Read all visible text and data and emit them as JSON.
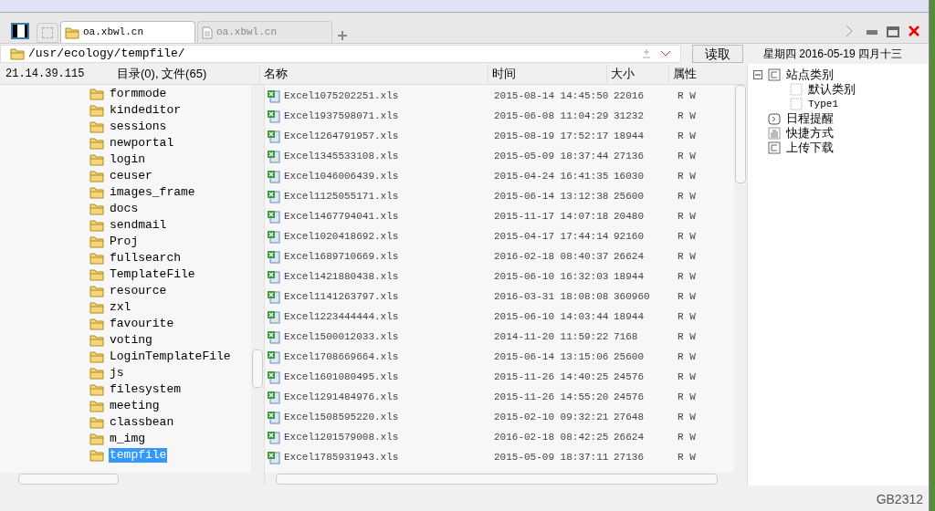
{
  "tabs": [
    {
      "label": "oa.xbwl.cn",
      "kind": "folder",
      "selected": true
    },
    {
      "label": "oa.xbwl.cn",
      "kind": "file",
      "selected": false
    }
  ],
  "path": "/usr/ecology/tempfile/",
  "read_button": "读取",
  "left_panel": {
    "host": "21.14.39.115",
    "counts": "目录(0), 文件(65)",
    "folders": [
      {
        "name": "formmode",
        "selected": false
      },
      {
        "name": "kindeditor",
        "selected": false
      },
      {
        "name": "sessions",
        "selected": false
      },
      {
        "name": "newportal",
        "selected": false
      },
      {
        "name": "login",
        "selected": false
      },
      {
        "name": "ceuser",
        "selected": false
      },
      {
        "name": "images_frame",
        "selected": false
      },
      {
        "name": "docs",
        "selected": false
      },
      {
        "name": "sendmail",
        "selected": false
      },
      {
        "name": "Proj",
        "selected": false
      },
      {
        "name": "fullsearch",
        "selected": false
      },
      {
        "name": "TemplateFile",
        "selected": false
      },
      {
        "name": "resource",
        "selected": false
      },
      {
        "name": "zxl",
        "selected": false
      },
      {
        "name": "favourite",
        "selected": false
      },
      {
        "name": "voting",
        "selected": false
      },
      {
        "name": "LoginTemplateFile",
        "selected": false
      },
      {
        "name": "js",
        "selected": false
      },
      {
        "name": "filesystem",
        "selected": false
      },
      {
        "name": "meeting",
        "selected": false
      },
      {
        "name": "classbean",
        "selected": false
      },
      {
        "name": "m_img",
        "selected": false
      },
      {
        "name": "tempfile",
        "selected": true
      }
    ]
  },
  "table": {
    "columns": [
      "名称",
      "时间",
      "大小",
      "属性"
    ],
    "rows": [
      {
        "name": "Excel1075202251.xls",
        "time": "2015-08-14 14:45:50",
        "size": "22016",
        "attr": "R W"
      },
      {
        "name": "Excel1937598071.xls",
        "time": "2015-06-08 11:04:29",
        "size": "31232",
        "attr": "R W"
      },
      {
        "name": "Excel1264791957.xls",
        "time": "2015-08-19 17:52:17",
        "size": "18944",
        "attr": "R W"
      },
      {
        "name": "Excel1345533108.xls",
        "time": "2015-05-09 18:37:44",
        "size": "27136",
        "attr": "R W"
      },
      {
        "name": "Excel1046006439.xls",
        "time": "2015-04-24 16:41:35",
        "size": "16030",
        "attr": "R W"
      },
      {
        "name": "Excel1125055171.xls",
        "time": "2015-06-14 13:12:38",
        "size": "25600",
        "attr": "R W"
      },
      {
        "name": "Excel1467794041.xls",
        "time": "2015-11-17 14:07:18",
        "size": "20480",
        "attr": "R W"
      },
      {
        "name": "Excel1020418692.xls",
        "time": "2015-04-17 17:44:14",
        "size": "92160",
        "attr": "R W"
      },
      {
        "name": "Excel1689710669.xls",
        "time": "2016-02-18 08:40:37",
        "size": "26624",
        "attr": "R W"
      },
      {
        "name": "Excel1421880438.xls",
        "time": "2015-06-10 16:32:03",
        "size": "18944",
        "attr": "R W"
      },
      {
        "name": "Excel1141263797.xls",
        "time": "2016-03-31 18:08:08",
        "size": "360960",
        "attr": "R W"
      },
      {
        "name": "Excel1223444444.xls",
        "time": "2015-06-10 14:03:44",
        "size": "18944",
        "attr": "R W"
      },
      {
        "name": "Excel1500012033.xls",
        "time": "2014-11-20 11:59:22",
        "size": "7168",
        "attr": "R W"
      },
      {
        "name": "Excel1708669664.xls",
        "time": "2015-06-14 13:15:06",
        "size": "25600",
        "attr": "R W"
      },
      {
        "name": "Excel1601080495.xls",
        "time": "2015-11-26 14:40:25",
        "size": "24576",
        "attr": "R W"
      },
      {
        "name": "Excel1291484976.xls",
        "time": "2015-11-26 14:55:20",
        "size": "24576",
        "attr": "R W"
      },
      {
        "name": "Excel1508595220.xls",
        "time": "2015-02-10 09:32:21",
        "size": "27648",
        "attr": "R W"
      },
      {
        "name": "Excel1201579008.xls",
        "time": "2016-02-18 08:42:25",
        "size": "26624",
        "attr": "R W"
      },
      {
        "name": "Excel1785931943.xls",
        "time": "2015-05-09 18:37:11",
        "size": "27136",
        "attr": "R W"
      }
    ]
  },
  "right_panel": {
    "date": "星期四 2016-05-19 四月十三",
    "tree": [
      {
        "label": "站点类别",
        "kind": "category",
        "expanded": true,
        "children": [
          {
            "label": "默认类别",
            "kind": "item"
          },
          {
            "label": "Type1",
            "kind": "item"
          }
        ]
      },
      {
        "label": "日程提醒",
        "kind": "schedule"
      },
      {
        "label": "快捷方式",
        "kind": "shortcut"
      },
      {
        "label": "上传下载",
        "kind": "category"
      }
    ]
  },
  "status_bar": {
    "encoding": "GB2312"
  }
}
